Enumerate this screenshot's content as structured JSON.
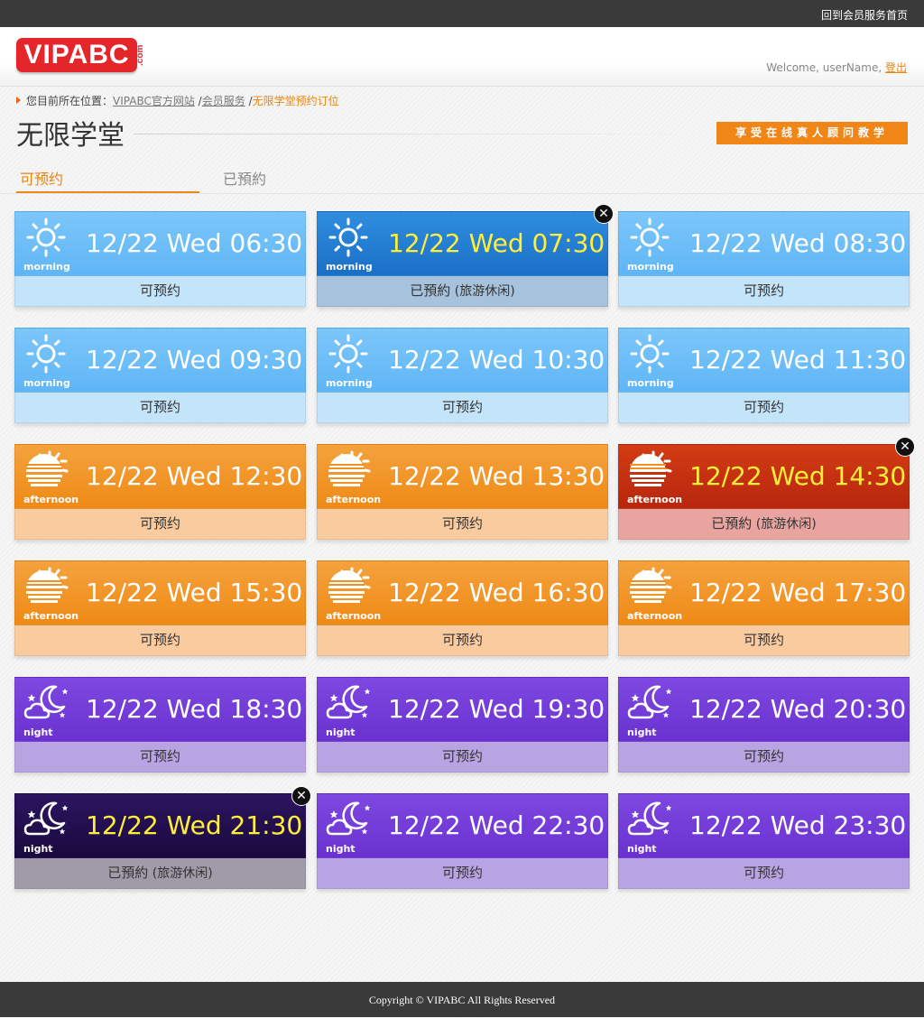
{
  "topbar": {
    "back_link": "回到会员服务首页"
  },
  "header": {
    "logo_text": "VIPABC",
    "logo_suffix": ".com",
    "welcome_text": "Welcome, userName,",
    "logout": "登出"
  },
  "breadcrumb": {
    "prefix": "您目前所在位置：",
    "items": [
      "VIPABC官方网站",
      "会员服务",
      "无限学堂预约订位"
    ],
    "separator": "/"
  },
  "page": {
    "title": "无限学堂",
    "promo": "享受在线真人顾问教学"
  },
  "tabs": {
    "available": "可预约",
    "booked": "已預約"
  },
  "labels": {
    "available": "可预约",
    "booked": "已預約",
    "booked_note": "(旅游休闲)",
    "close": "✕"
  },
  "periods": {
    "morning": "morning",
    "afternoon": "afternoon",
    "night": "night"
  },
  "slots": [
    {
      "time": "12/22 Wed 06:30",
      "period": "morning",
      "status": "可预约",
      "booked": false
    },
    {
      "time": "12/22 Wed 07:30",
      "period": "morning",
      "status": "已預約",
      "note": "(旅游休闲)",
      "booked": true
    },
    {
      "time": "12/22 Wed 08:30",
      "period": "morning",
      "status": "可预约",
      "booked": false
    },
    {
      "time": "12/22 Wed 09:30",
      "period": "morning",
      "status": "可预约",
      "booked": false
    },
    {
      "time": "12/22 Wed 10:30",
      "period": "morning",
      "status": "可预约",
      "booked": false
    },
    {
      "time": "12/22 Wed 11:30",
      "period": "morning",
      "status": "可预约",
      "booked": false
    },
    {
      "time": "12/22 Wed 12:30",
      "period": "afternoon",
      "status": "可预约",
      "booked": false
    },
    {
      "time": "12/22 Wed 13:30",
      "period": "afternoon",
      "status": "可预约",
      "booked": false
    },
    {
      "time": "12/22 Wed 14:30",
      "period": "afternoon",
      "status": "已預約",
      "note": "(旅游休闲)",
      "booked": true
    },
    {
      "time": "12/22 Wed 15:30",
      "period": "afternoon",
      "status": "可预约",
      "booked": false
    },
    {
      "time": "12/22 Wed 16:30",
      "period": "afternoon",
      "status": "可预约",
      "booked": false
    },
    {
      "time": "12/22 Wed 17:30",
      "period": "afternoon",
      "status": "可预约",
      "booked": false
    },
    {
      "time": "12/22 Wed 18:30",
      "period": "night",
      "status": "可预约",
      "booked": false
    },
    {
      "time": "12/22 Wed 19:30",
      "period": "night",
      "status": "可预约",
      "booked": false
    },
    {
      "time": "12/22 Wed 20:30",
      "period": "night",
      "status": "可预约",
      "booked": false
    },
    {
      "time": "12/22 Wed 21:30",
      "period": "night",
      "status": "已預約",
      "note": "(旅游休闲)",
      "booked": true
    },
    {
      "time": "12/22 Wed 22:30",
      "period": "night",
      "status": "可预约",
      "booked": false
    },
    {
      "time": "12/22 Wed 23:30",
      "period": "night",
      "status": "可预约",
      "booked": false
    }
  ],
  "icons": {
    "morning": "sun-icon",
    "afternoon": "sunset-icon",
    "night": "moon-cloud-icon"
  },
  "colors": {
    "accent": "#f08518",
    "morning": "#6bbdf8",
    "morning_booked": "#2280d4",
    "afternoon": "#f09022",
    "afternoon_booked": "#c63010",
    "night": "#7440d8",
    "night_booked": "#22104e",
    "booked_time_text": "#ffef3a"
  },
  "footer": {
    "copyright": "Copyright © VIPABC All Rights Reserved"
  }
}
